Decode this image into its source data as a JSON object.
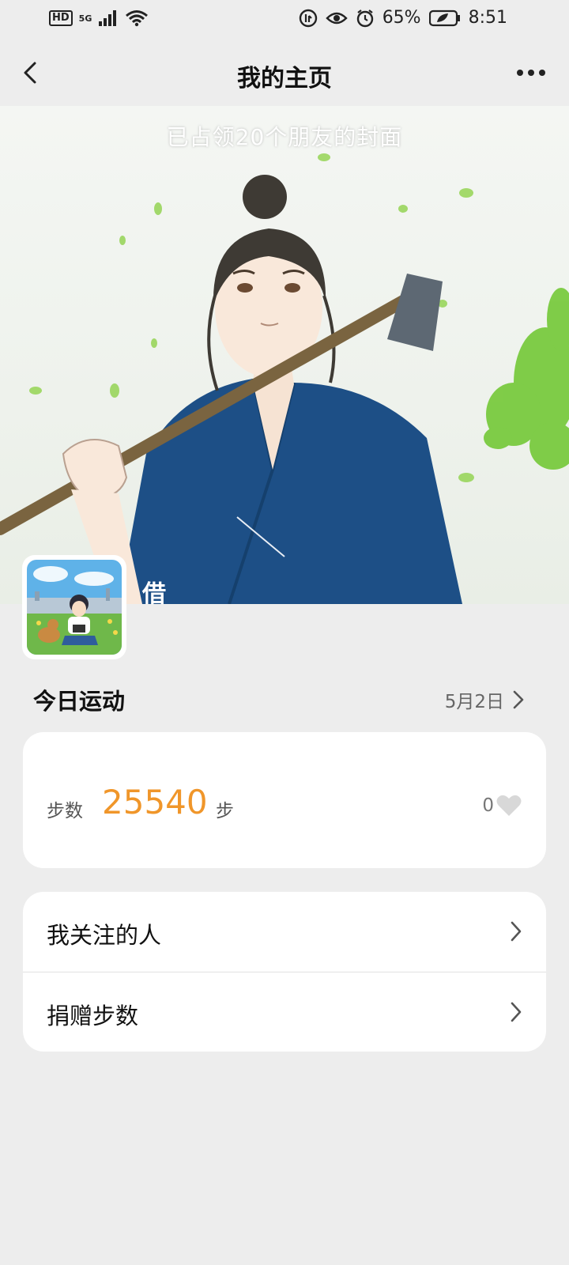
{
  "status_bar": {
    "hd": "HD",
    "network": "5G",
    "battery_percent": "65%",
    "time": "8:51"
  },
  "nav": {
    "title": "我的主页"
  },
  "cover": {
    "caption": "已占领20个朋友的封面"
  },
  "profile": {
    "username": "借"
  },
  "today": {
    "title": "今日运动",
    "date": "5月2日"
  },
  "steps": {
    "label": "步数",
    "value": "25540",
    "unit": "步",
    "likes": "0"
  },
  "menu": [
    {
      "label": "我关注的人"
    },
    {
      "label": "捐赠步数"
    }
  ],
  "colors": {
    "accent": "#f0962a",
    "background": "#ededed",
    "card": "#ffffff"
  }
}
